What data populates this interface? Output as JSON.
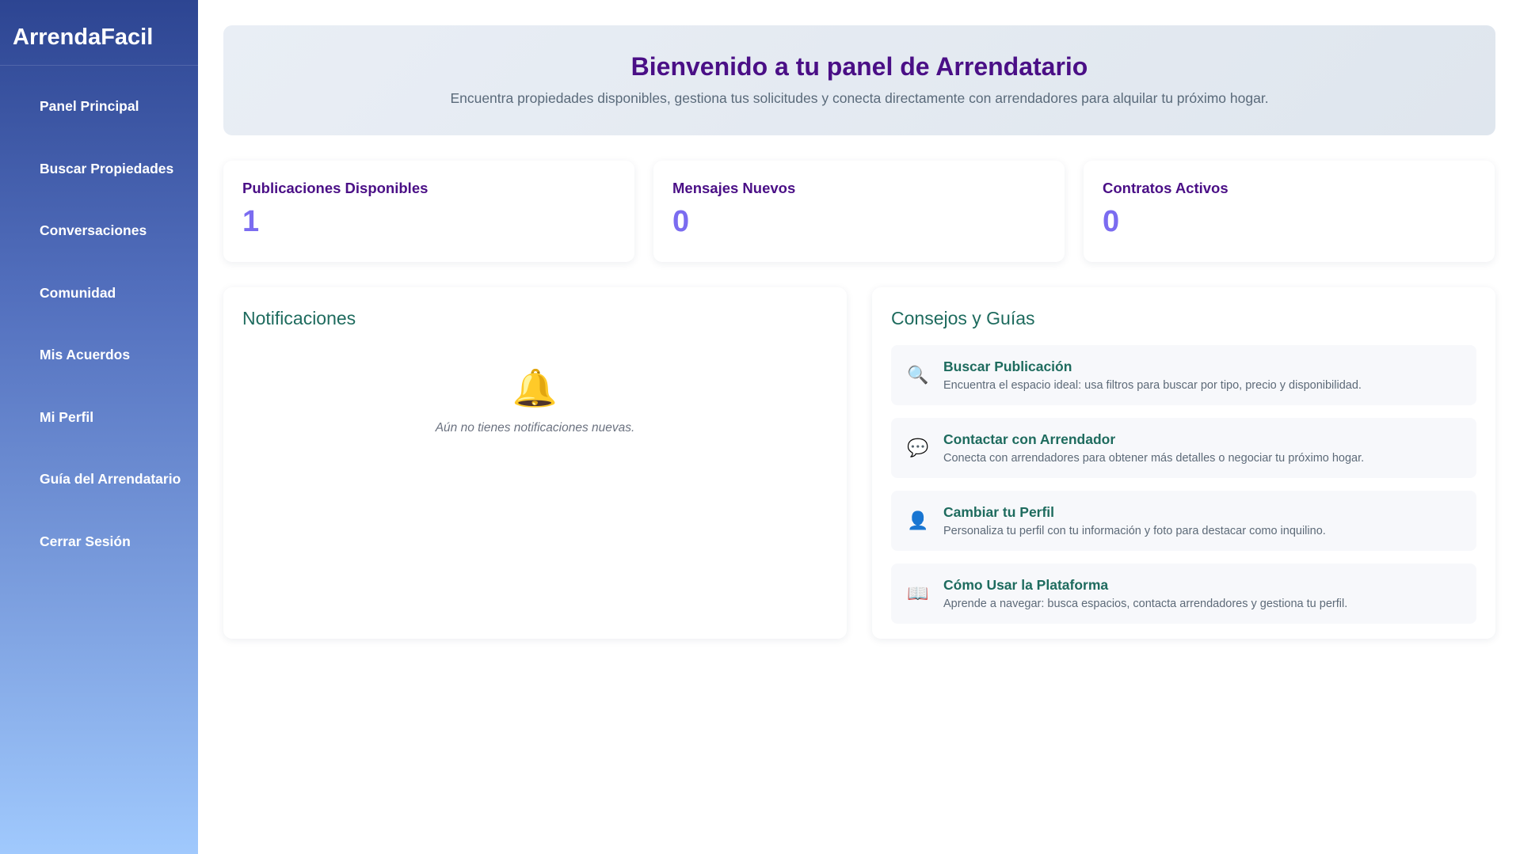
{
  "sidebar": {
    "brand": "ArrendaFacil",
    "items": [
      {
        "label": "Panel Principal"
      },
      {
        "label": "Buscar Propiedades"
      },
      {
        "label": "Conversaciones"
      },
      {
        "label": "Comunidad"
      },
      {
        "label": "Mis Acuerdos"
      },
      {
        "label": "Mi Perfil"
      },
      {
        "label": "Guía del Arrendatario"
      },
      {
        "label": "Cerrar Sesión"
      }
    ]
  },
  "hero": {
    "title": "Bienvenido a tu panel de Arrendatario",
    "subtitle": "Encuentra propiedades disponibles, gestiona tus solicitudes y conecta directamente con arrendadores para alquilar tu próximo hogar."
  },
  "stats": [
    {
      "label": "Publicaciones Disponibles",
      "value": "1"
    },
    {
      "label": "Mensajes Nuevos",
      "value": "0"
    },
    {
      "label": "Contratos Activos",
      "value": "0"
    }
  ],
  "notifications": {
    "title": "Notificaciones",
    "icon": "bell-icon",
    "empty_text": "Aún no tienes notificaciones nuevas."
  },
  "tips": {
    "title": "Consejos y Guías",
    "items": [
      {
        "icon": "magnifier-icon",
        "title": "Buscar Publicación",
        "desc": "Encuentra el espacio ideal: usa filtros para buscar por tipo, precio y disponibilidad."
      },
      {
        "icon": "speech-bubble-icon",
        "title": "Contactar con Arrendador",
        "desc": "Conecta con arrendadores para obtener más detalles o negociar tu próximo hogar."
      },
      {
        "icon": "user-icon",
        "title": "Cambiar tu Perfil",
        "desc": "Personaliza tu perfil con tu información y foto para destacar como inquilino."
      },
      {
        "icon": "book-icon",
        "title": "Cómo Usar la Plataforma",
        "desc": "Aprende a navegar: busca espacios, contacta arrendadores y gestiona tu perfil."
      }
    ]
  },
  "colors": {
    "accent_purple": "#4a0f86",
    "stat_value": "#7b6cf0",
    "teal": "#1e6b5e",
    "sidebar_top": "#2d4592",
    "sidebar_bottom": "#a0c9fd"
  }
}
